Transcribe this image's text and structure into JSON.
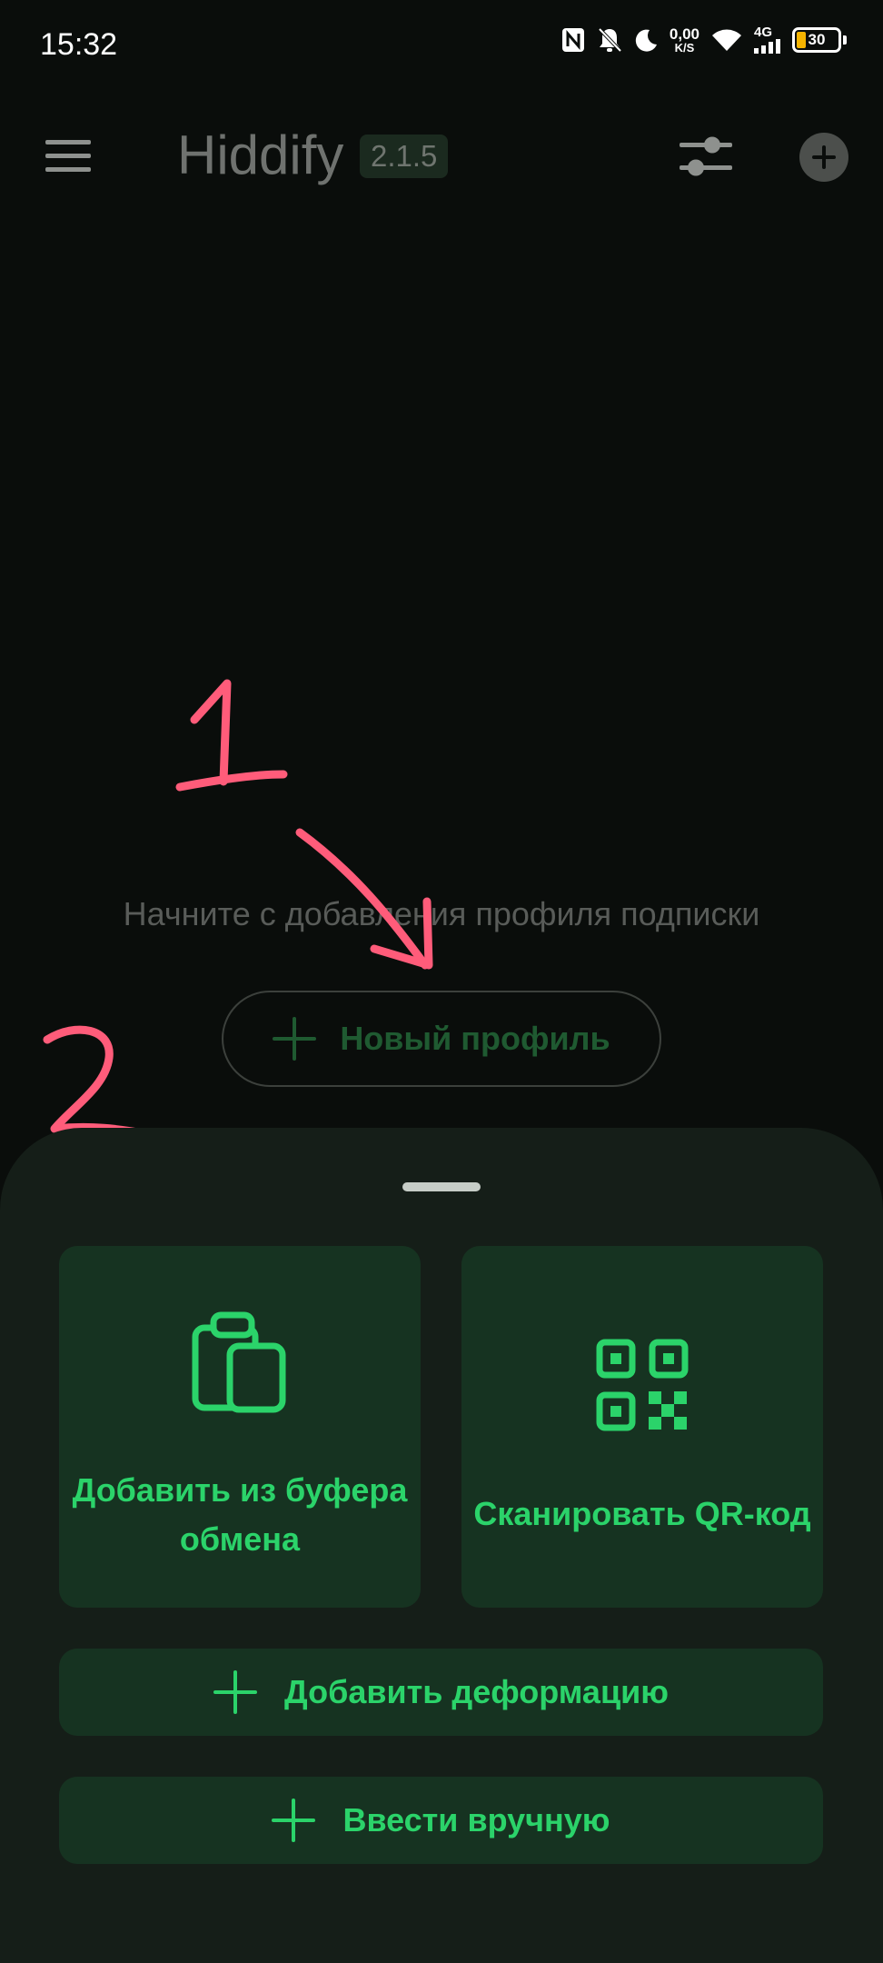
{
  "status_bar": {
    "time": "15:32",
    "net_speed_value": "0,00",
    "net_speed_unit": "K/S",
    "network_type": "4G",
    "battery_level": "30",
    "icons": [
      "nfc-icon",
      "bell-off-icon",
      "moon-icon",
      "wifi-icon",
      "signal-icon",
      "battery-icon"
    ]
  },
  "app_bar": {
    "title": "Hiddify",
    "version": "2.1.5",
    "icons": [
      "menu-icon",
      "tune-icon",
      "add-circle-icon"
    ]
  },
  "empty_state": {
    "hint": "Начните с добавления профиля подписки",
    "new_profile_label": "Новый профиль"
  },
  "annotations": {
    "marker_1": "1",
    "marker_2": "2",
    "color": "#ff5c7a"
  },
  "bottom_sheet": {
    "clipboard_label": "Добавить из буфера обмена",
    "qr_label": "Сканировать QR-код",
    "add_warp_label": "Добавить деформацию",
    "manual_label": "Ввести вручную"
  },
  "colors": {
    "accent": "#2bd36a",
    "tile_bg": "#163321",
    "sheet_bg": "#151e18",
    "background": "#0a0d0b"
  }
}
